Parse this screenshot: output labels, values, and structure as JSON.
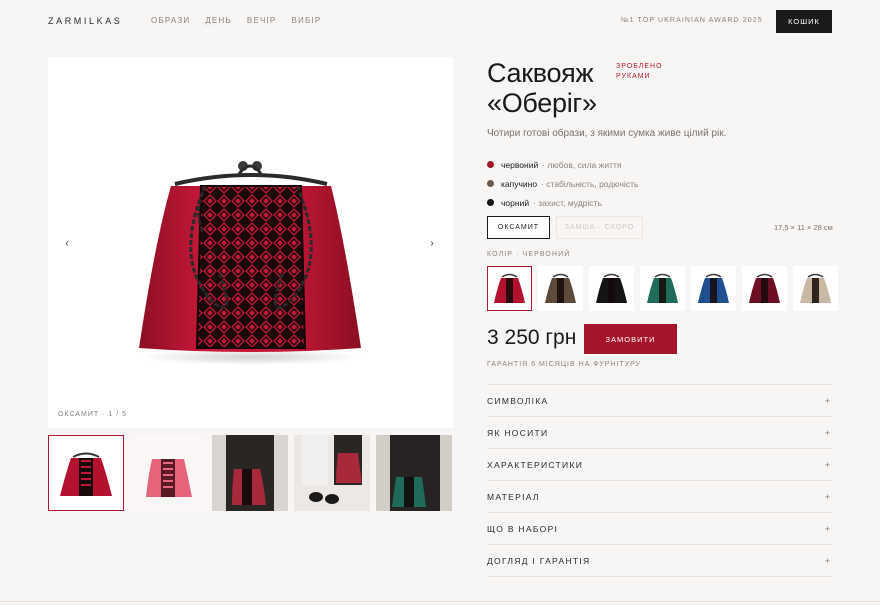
{
  "header": {
    "logo": "ZARMILKAS",
    "nav": [
      "ОБРАЗИ",
      "ДЕНЬ",
      "ВЕЧІР",
      "ВИБІР"
    ],
    "award": "№1 TOP UKRAINIAN AWARD 2025",
    "cart_label": "КОШИК"
  },
  "gallery": {
    "prev_icon": "chevron-left-icon",
    "next_icon": "chevron-right-icon",
    "prev_glyph": "‹",
    "next_glyph": "›",
    "counter": "ОКСАМИТ · 1 / 5",
    "thumbnail_count": 5
  },
  "product": {
    "title_line1": "Саквояж",
    "title_line2": "«Оберіг»",
    "handmade_line1": "ЗРОБЛЕНО",
    "handmade_line2": "РУКАМИ",
    "subtitle": "Чотири готові образи, з якими сумка живе цілий рік.",
    "meanings": [
      {
        "name": "червоний",
        "desc": "· любов, сила життя",
        "color": "#a5142a"
      },
      {
        "name": "капучино",
        "desc": "· стабільність, родючість",
        "color": "#6b5a4c"
      },
      {
        "name": "чорний",
        "desc": "· захист, мудрість",
        "color": "#111111"
      }
    ],
    "material_active": "ОКСАМИТ",
    "material_disabled": "ЗАМША · СКОРО",
    "dimensions": "17,5 × 11 × 28 см",
    "color_label": "КОЛІР · ЧЕРВОНИЙ",
    "swatches": [
      "#b3122e",
      "#5e4a3a",
      "#141414",
      "#1d6b58",
      "#1f4f8f",
      "#6d0f22",
      "#c9b8a4"
    ],
    "price": "3 250 грн",
    "order_label": "ЗАМОВИТИ",
    "warranty": "ГАРАНТІЯ 6 МІСЯЦІВ НА ФУРНІТУРУ"
  },
  "accordion": [
    {
      "label": "СИМВОЛІКА",
      "icon": "+"
    },
    {
      "label": "ЯК НОСИТИ",
      "icon": "+"
    },
    {
      "label": "ХАРАКТЕРИСТИКИ",
      "icon": "+"
    },
    {
      "label": "МАТЕРІАЛ",
      "icon": "+"
    },
    {
      "label": "ЩО В НАБОРІ",
      "icon": "+"
    },
    {
      "label": "ДОГЛЯД І ГАРАНТІЯ",
      "icon": "+"
    }
  ]
}
